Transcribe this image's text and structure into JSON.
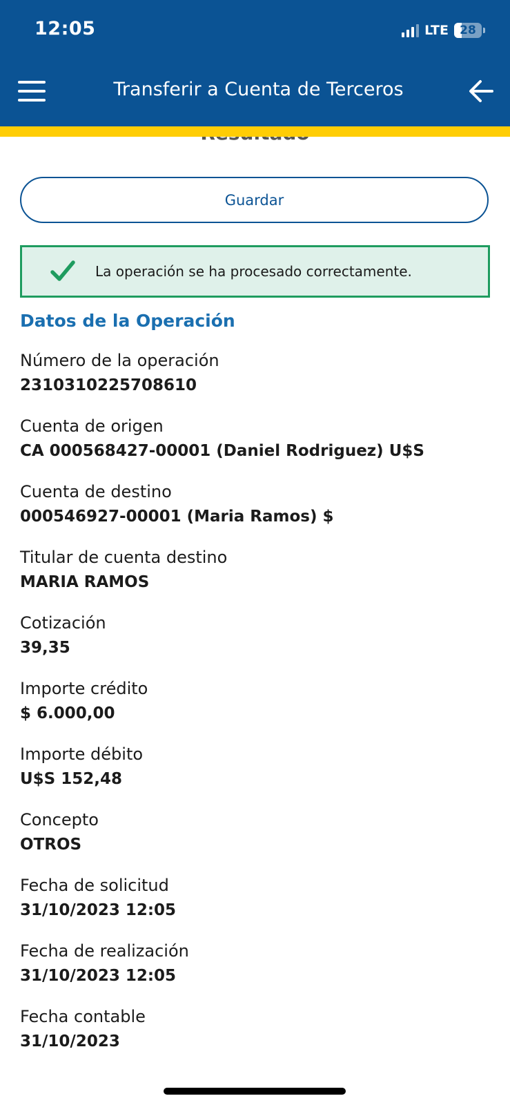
{
  "status_bar": {
    "time": "12:05",
    "network": "LTE",
    "battery": "28",
    "battery_level": 0.28
  },
  "nav": {
    "title": "Transferir a Cuenta de Terceros",
    "menu_icon": "hamburger-menu-icon",
    "back_icon": "arrow-left-icon"
  },
  "colors": {
    "brand_blue": "#0b5394",
    "accent_yellow": "#ffcd05",
    "success_green": "#1e9c5f",
    "success_bg": "#dff1ea",
    "heading_blue": "#1a6fb0"
  },
  "page": {
    "section_heading": "Resultado",
    "save_label": "Guardar",
    "success_message": "La operación se ha procesado correctamente.",
    "success_icon": "checkmark-icon",
    "operation_title": "Datos de la Operación"
  },
  "operation": {
    "fields": [
      {
        "label": "Número de la operación",
        "value": "2310310225708610"
      },
      {
        "label": "Cuenta de origen",
        "value": "CA 000568427-00001 (Daniel Rodriguez) U$S"
      },
      {
        "label": "Cuenta de destino",
        "value": "000546927-00001 (Maria Ramos) $"
      },
      {
        "label": "Titular de cuenta destino",
        "value": "MARIA RAMOS"
      },
      {
        "label": "Cotización",
        "value": "39,35"
      },
      {
        "label": "Importe crédito",
        "value": "$ 6.000,00"
      },
      {
        "label": "Importe débito",
        "value": "U$S 152,48"
      },
      {
        "label": "Concepto",
        "value": "OTROS"
      },
      {
        "label": "Fecha de solicitud",
        "value": "31/10/2023 12:05"
      },
      {
        "label": "Fecha de realización",
        "value": "31/10/2023 12:05"
      },
      {
        "label": "Fecha contable",
        "value": "31/10/2023"
      }
    ]
  }
}
